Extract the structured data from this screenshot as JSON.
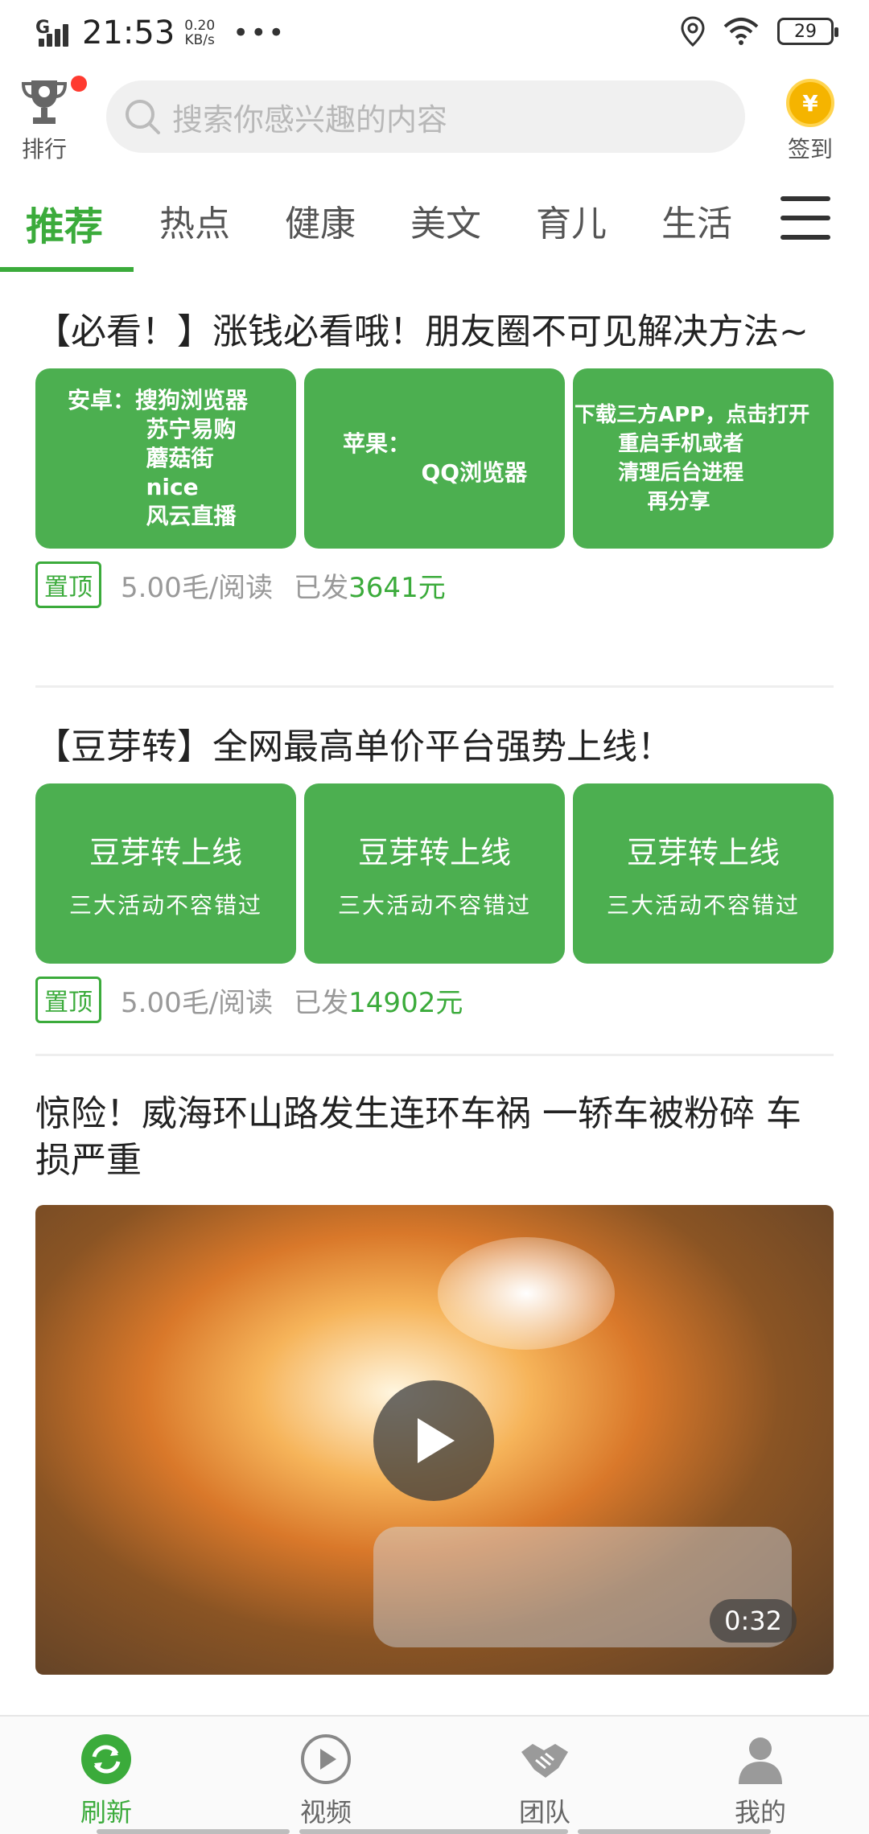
{
  "status_bar": {
    "network": "G",
    "time": "21:53",
    "speed_value": "0.20",
    "speed_unit": "KB/s",
    "dots": "•••",
    "battery": "29"
  },
  "header": {
    "rank_label": "排行",
    "search_placeholder": "搜索你感兴趣的内容",
    "signin_label": "签到",
    "coin_symbol": "¥"
  },
  "tabs": [
    {
      "label": "推荐",
      "active": true
    },
    {
      "label": "热点"
    },
    {
      "label": "健康"
    },
    {
      "label": "美文"
    },
    {
      "label": "育儿"
    },
    {
      "label": "生活"
    }
  ],
  "articles": [
    {
      "title": "【必看！】涨钱必看哦！朋友圈不可见解决方法~",
      "thumbs": [
        "安卓：搜狗浏览器\n          苏宁易购\n          蘑菇街\n          nice\n          风云直播",
        "苹果：\n          QQ浏览器",
        "下载三方APP，点击打开\n      重启手机或者\n      清理后台进程\n          再分享"
      ],
      "pin": "置顶",
      "price": "5.00毛/阅读",
      "sent_label": "已发",
      "amount": "3641元"
    },
    {
      "title": "【豆芽转】全网最高单价平台强势上线！",
      "thumb_main": "豆芽转上线",
      "thumb_sub": "三大活动不容错过",
      "pin": "置顶",
      "price": "5.00毛/阅读",
      "sent_label": "已发",
      "amount": "14902元"
    },
    {
      "title": " 惊险！威海环山路发生连环车祸 一轿车被粉碎 车损严重",
      "duration": "0:32"
    }
  ],
  "bottom_nav": [
    {
      "label": "刷新",
      "active": true
    },
    {
      "label": "视频"
    },
    {
      "label": "团队"
    },
    {
      "label": "我的"
    }
  ],
  "colors": {
    "accent": "#3bab3b",
    "thumb_bg": "#4caf50",
    "badge_red": "#ff3b30",
    "coin": "#f5b400"
  }
}
